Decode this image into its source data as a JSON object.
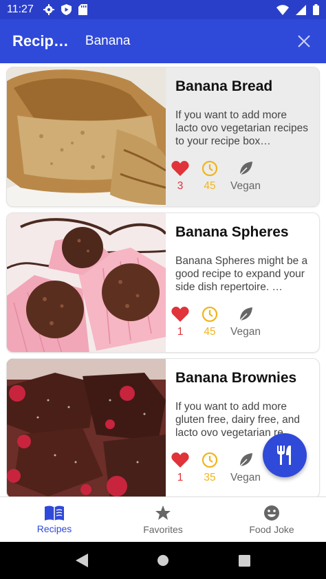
{
  "status_bar": {
    "time": "11:27"
  },
  "app_bar": {
    "title": "Recip…",
    "search_query": "Banana"
  },
  "recipes": [
    {
      "title": "Banana Bread",
      "description": "If you want to add more lacto ovo vegetarian recipes to your recipe box…",
      "likes": "3",
      "minutes": "45",
      "diet": "Vegan",
      "selected": true
    },
    {
      "title": "Banana Spheres",
      "description": "Banana Spheres might be a good recipe to expand your side dish repertoire. …",
      "likes": "1",
      "minutes": "45",
      "diet": "Vegan",
      "selected": false
    },
    {
      "title": "Banana Brownies",
      "description": "If you want to add more gluten free, dairy free, and lacto ovo vegetarian re…",
      "likes": "1",
      "minutes": "35",
      "diet": "Vegan",
      "selected": false
    }
  ],
  "bottom_nav": [
    {
      "label": "Recipes",
      "icon": "book-icon",
      "active": true
    },
    {
      "label": "Favorites",
      "icon": "star-icon",
      "active": false
    },
    {
      "label": "Food Joke",
      "icon": "smiley-icon",
      "active": false
    }
  ],
  "colors": {
    "primary": "#2f49d9",
    "status_bar": "#2a3fc9",
    "heart": "#e0333a",
    "clock": "#f2b41a"
  }
}
